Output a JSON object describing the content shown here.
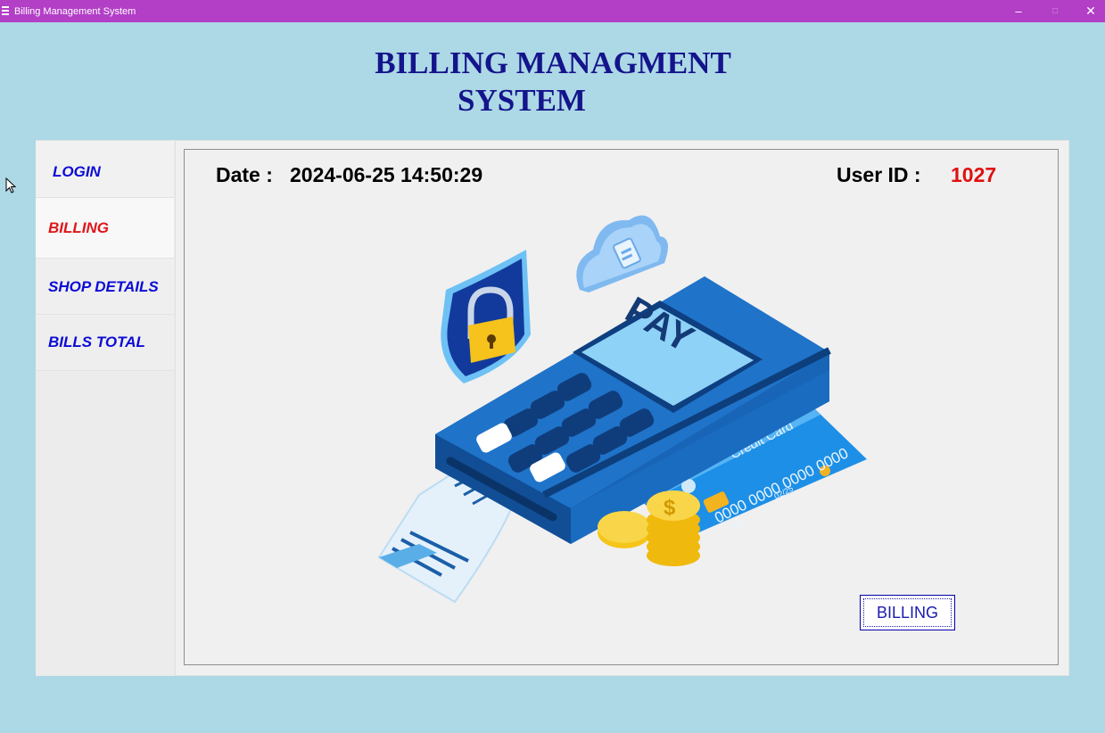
{
  "window": {
    "title": "Billing Management System",
    "controls": {
      "minimize": "–",
      "maximize": "□",
      "close": "✕"
    }
  },
  "header": {
    "title_line1": "BILLING MANAGMENT",
    "title_line2": "SYSTEM"
  },
  "sidebar": {
    "items": [
      {
        "label": "LOGIN",
        "active": false
      },
      {
        "label": "BILLING",
        "active": true
      },
      {
        "label": "SHOP DETAILS",
        "active": false
      },
      {
        "label": "BILLS TOTAL",
        "active": false
      }
    ]
  },
  "content": {
    "date_label": "Date :",
    "date_value": "2024-06-25 14:50:29",
    "user_id_label": "User ID :",
    "user_id_value": "1027",
    "billing_button": "BILLING"
  },
  "illustration": {
    "terminal_screen_text": "PAY",
    "card_title": "Credit Card",
    "card_number": "0000 0000 0000 0000",
    "card_expiry": "02/25",
    "card_holder_digits": "0000",
    "coin_symbol": "$",
    "icons": [
      "shield-lock-icon",
      "cloud-save-icon",
      "payment-terminal",
      "credit-card",
      "coin-stack",
      "receipt"
    ]
  },
  "colors": {
    "titlebar": "#b23fc6",
    "background": "#add8e6",
    "nav_text": "#0b0bd6",
    "nav_active": "#e0161a",
    "heading": "#14148c",
    "user_id": "#e01010"
  }
}
